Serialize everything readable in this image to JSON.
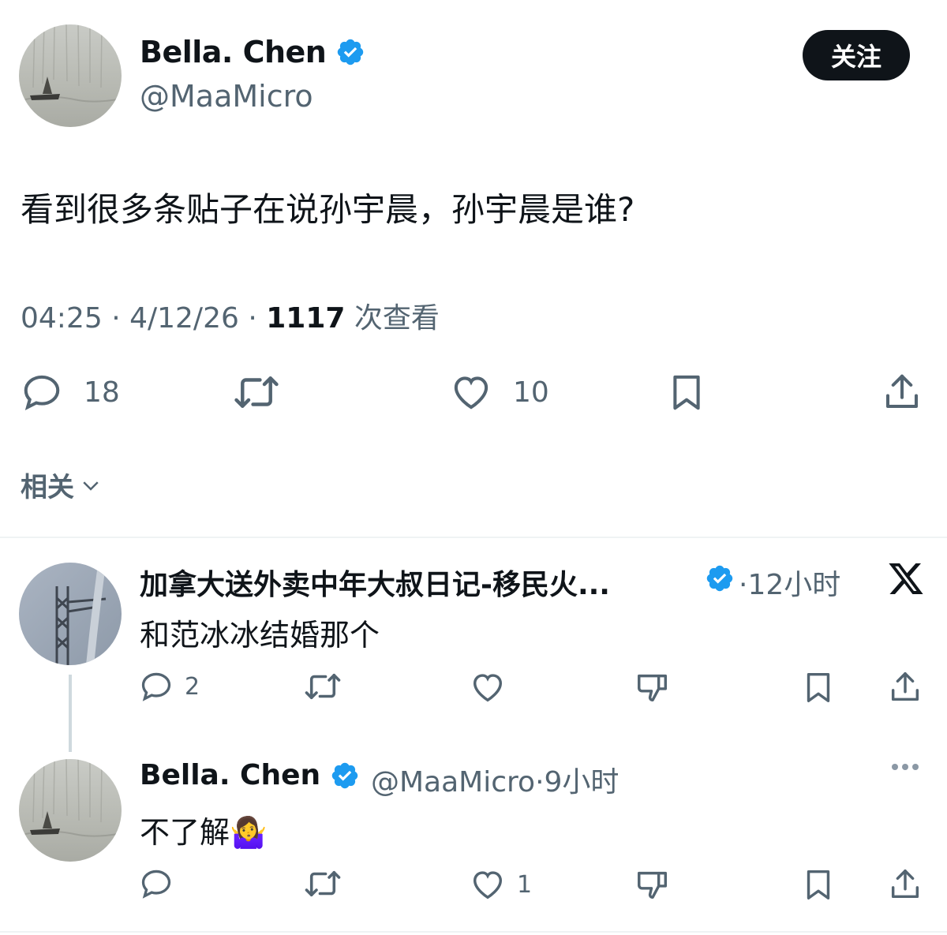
{
  "main_tweet": {
    "author_name": "Bella. Chen",
    "author_handle": "@MaaMicro",
    "follow_label": "关注",
    "text": "看到很多条贴子在说孙宇晨，孙宇晨是谁?",
    "time": "04:25",
    "date": "4/12/26",
    "views_count": "1117",
    "views_label": "次查看",
    "reply_count": "18",
    "like_count": "10",
    "related_label": "相关"
  },
  "replies": [
    {
      "author_name": "加拿大送外卖中年大叔日记-移民火...",
      "time": "12小时",
      "text": "和范冰冰结婚那个",
      "reply_count": "2",
      "like_count": ""
    },
    {
      "author_name": "Bella. Chen",
      "author_handle": "@MaaMicro",
      "time": "9小时",
      "text": "不了解🤷‍♀️",
      "reply_count": "",
      "like_count": "1"
    }
  ],
  "colors": {
    "verified_blue": "#1d9bf0",
    "text_primary": "#0f1419",
    "text_secondary": "#536471",
    "divider": "#eff3f4"
  }
}
